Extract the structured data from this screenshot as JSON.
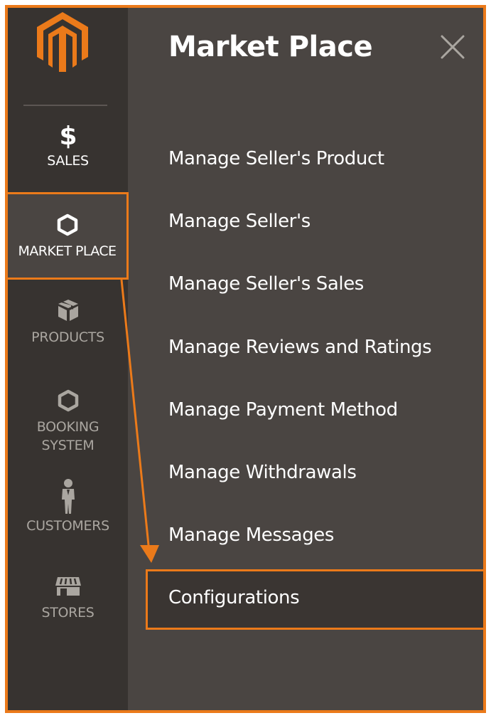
{
  "sidebar": {
    "logo": "magento-logo",
    "items": [
      {
        "label": "SALES",
        "icon": "dollar-icon"
      },
      {
        "label": "MARKET PLACE",
        "icon": "hexagon-icon"
      },
      {
        "label": "PRODUCTS",
        "icon": "box-icon"
      },
      {
        "label": "BOOKING\nSYSTEM",
        "icon": "hexagon-icon"
      },
      {
        "label": "CUSTOMERS",
        "icon": "person-icon"
      },
      {
        "label": "STORES",
        "icon": "storefront-icon"
      }
    ]
  },
  "panel": {
    "title": "Market Place",
    "close_icon": "close-icon",
    "menu": [
      "Manage Seller's Product",
      "Manage Seller's",
      "Manage Seller's Sales",
      "Manage Reviews and Ratings",
      "Manage Payment Method",
      "Manage Withdrawals",
      "Manage Messages",
      "Configurations"
    ]
  },
  "colors": {
    "accent": "#eb7a1a",
    "sidebar_bg": "#373330",
    "panel_bg": "#4a4542",
    "text": "#ffffff",
    "muted_text": "#aaa6a0"
  }
}
